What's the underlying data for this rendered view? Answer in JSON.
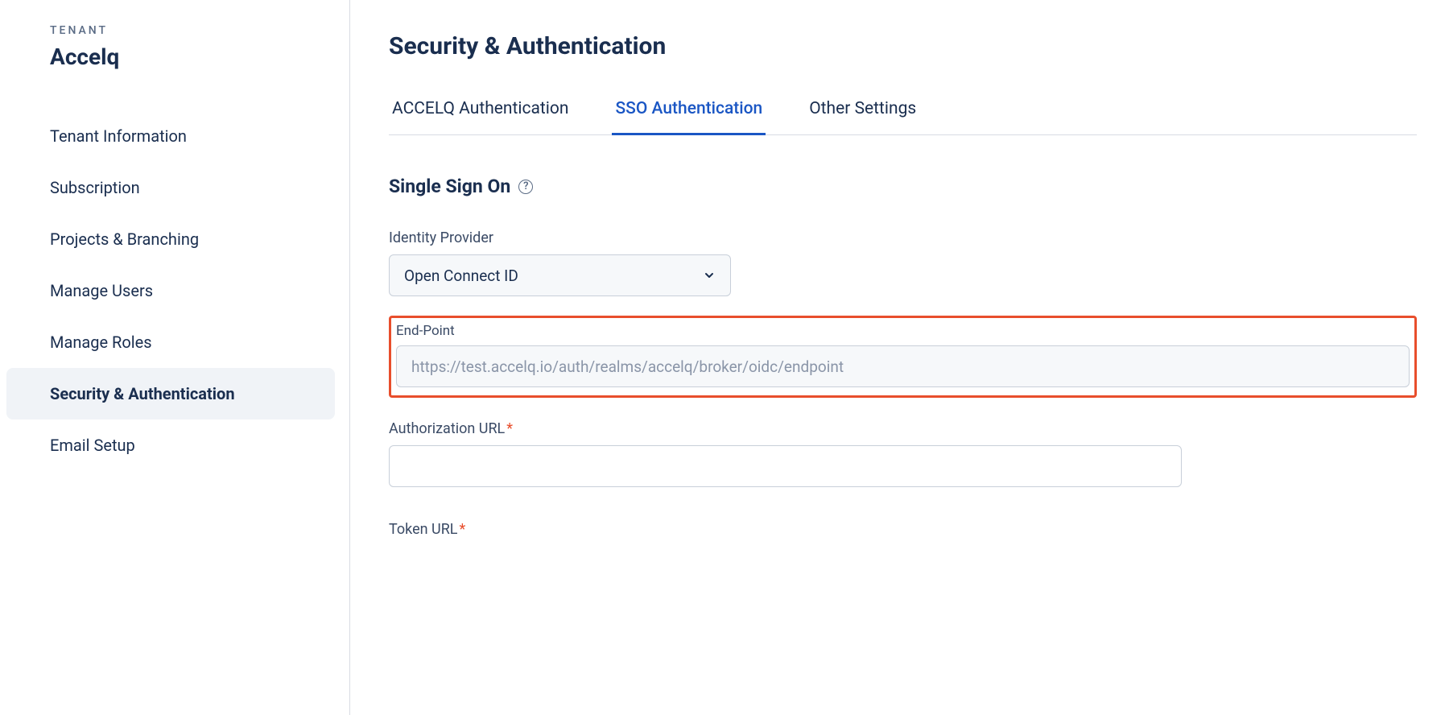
{
  "sidebar": {
    "tenant_label": "TENANT",
    "tenant_name": "Accelq",
    "items": [
      {
        "label": "Tenant Information",
        "active": false
      },
      {
        "label": "Subscription",
        "active": false
      },
      {
        "label": "Projects & Branching",
        "active": false
      },
      {
        "label": "Manage Users",
        "active": false
      },
      {
        "label": "Manage Roles",
        "active": false
      },
      {
        "label": "Security & Authentication",
        "active": true
      },
      {
        "label": "Email Setup",
        "active": false
      }
    ]
  },
  "main": {
    "title": "Security & Authentication",
    "tabs": [
      {
        "label": "ACCELQ Authentication",
        "active": false
      },
      {
        "label": "SSO Authentication",
        "active": true
      },
      {
        "label": "Other Settings",
        "active": false
      }
    ],
    "section_title": "Single Sign On",
    "identity_provider": {
      "label": "Identity Provider",
      "value": "Open Connect ID"
    },
    "endpoint": {
      "label": "End-Point",
      "value": "https://test.accelq.io/auth/realms/accelq/broker/oidc/endpoint"
    },
    "authorization_url": {
      "label": "Authorization URL",
      "value": ""
    },
    "token_url": {
      "label": "Token URL",
      "value": ""
    }
  }
}
